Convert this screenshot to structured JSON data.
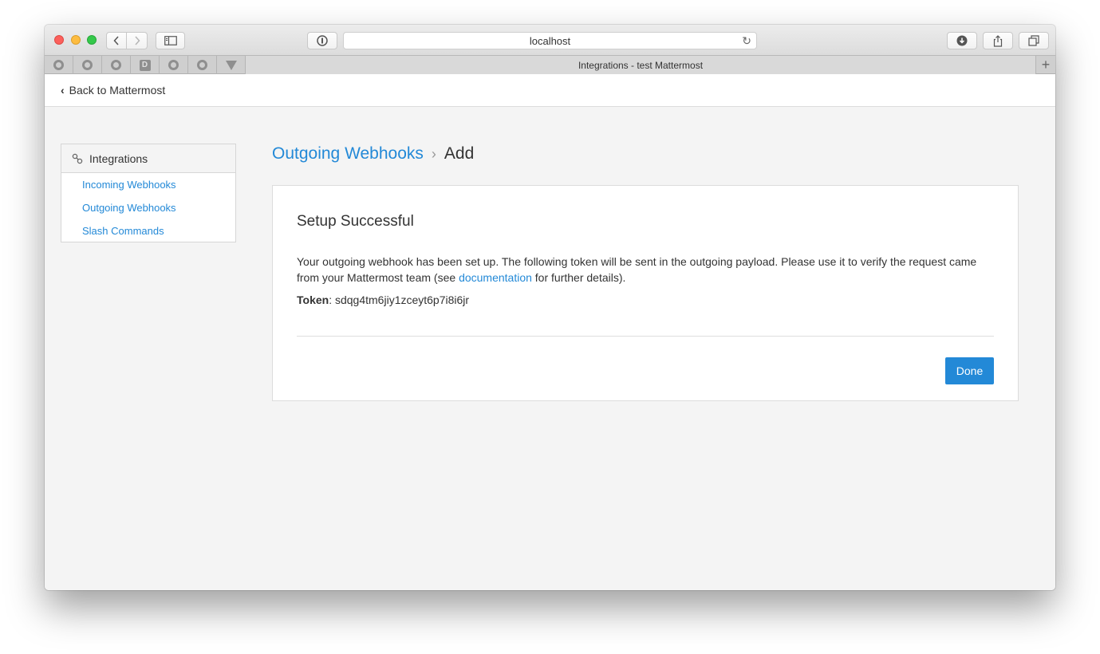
{
  "browser": {
    "url": "localhost",
    "tab_title": "Integrations - test Mattermost",
    "pinned_tabs": [
      {
        "icon": "github-icon"
      },
      {
        "icon": "github-icon"
      },
      {
        "icon": "github-icon"
      },
      {
        "icon": "d-icon",
        "letter": "D"
      },
      {
        "icon": "github-icon"
      },
      {
        "icon": "github-icon"
      },
      {
        "icon": "triangle-icon"
      }
    ],
    "new_tab_label": "+"
  },
  "header": {
    "back_label": "Back to Mattermost"
  },
  "sidebar": {
    "title": "Integrations",
    "items": [
      {
        "label": "Incoming Webhooks"
      },
      {
        "label": "Outgoing Webhooks"
      },
      {
        "label": "Slash Commands"
      }
    ]
  },
  "breadcrumb": {
    "parent": "Outgoing Webhooks",
    "current": "Add"
  },
  "card": {
    "title": "Setup Successful",
    "body_pre": "Your outgoing webhook has been set up. The following token will be sent in the outgoing payload. Please use it to verify the request came from your Mattermost team (see ",
    "body_link": "documentation",
    "body_post": " for further details).",
    "token_label": "Token",
    "token_value": "sdqg4tm6jiy1zceyt6p7i8i6jr",
    "done_label": "Done"
  },
  "colors": {
    "accent": "#2389d7",
    "background": "#f4f4f4"
  }
}
